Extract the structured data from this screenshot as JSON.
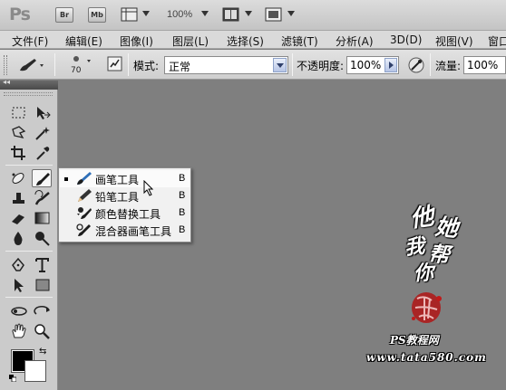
{
  "appbar": {
    "logo": "Ps",
    "bridge_label": "Br",
    "minibridge_label": "Mb",
    "zoom": "100%"
  },
  "menubar": {
    "items": [
      "文件(F)",
      "编辑(E)",
      "图像(I)",
      "图层(L)",
      "选择(S)",
      "滤镜(T)",
      "分析(A)",
      "3D(D)",
      "视图(V)",
      "窗口"
    ]
  },
  "options": {
    "brush_size": "70",
    "mode_label": "模式:",
    "mode_value": "正常",
    "opacity_label": "不透明度:",
    "opacity_value": "100%",
    "flow_label": "流量:",
    "flow_value": "100%"
  },
  "flyout": {
    "items": [
      {
        "label": "画笔工具",
        "key": "B",
        "icon": "brush-icon",
        "selected": true
      },
      {
        "label": "铅笔工具",
        "key": "B",
        "icon": "pencil-icon",
        "selected": false
      },
      {
        "label": "颜色替换工具",
        "key": "B",
        "icon": "color-replacement-icon",
        "selected": false
      },
      {
        "label": "混合器画笔工具",
        "key": "B",
        "icon": "mixer-brush-icon",
        "selected": false
      }
    ]
  },
  "colors": {
    "foreground": "#000000",
    "background": "#ffffff",
    "canvas": "#7f7f7f"
  },
  "watermark": {
    "calligraphy": [
      "他",
      "她",
      "我",
      "帮",
      "你"
    ],
    "site_title": "PS教程网",
    "site_url": "www.tata580.com"
  }
}
